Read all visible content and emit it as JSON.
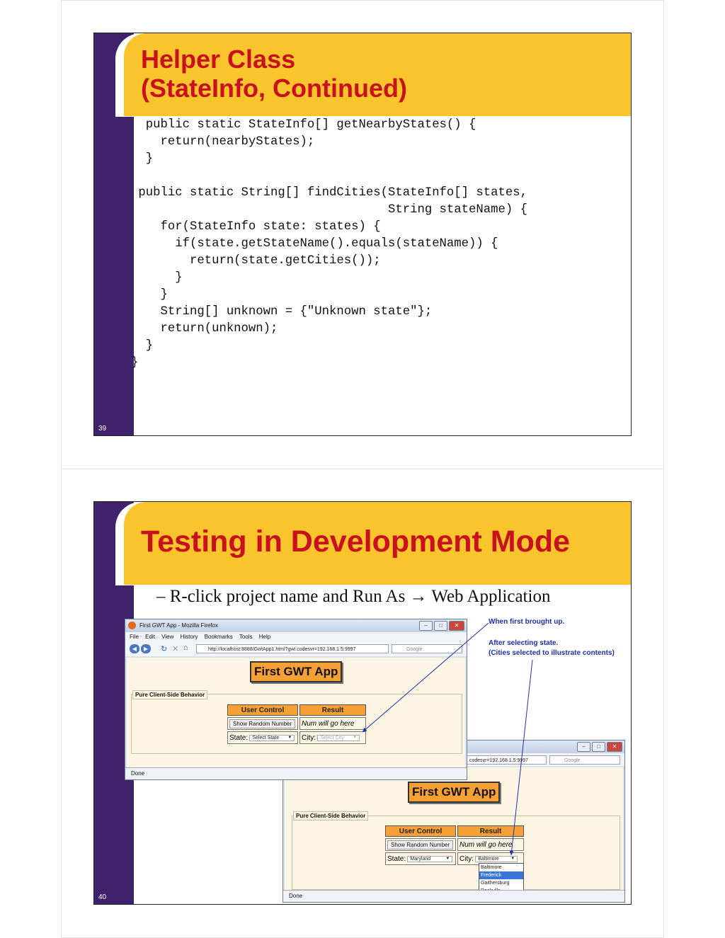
{
  "slide1": {
    "title_line1": "Helper Class",
    "title_line2": "(StateInfo, Continued)",
    "code": "  public static StateInfo[] getNearbyStates() {\n    return(nearbyStates);\n  }\n\n public static String[] findCities(StateInfo[] states,\n                                   String stateName) {\n    for(StateInfo state: states) {\n      if(state.getStateName().equals(stateName)) {\n        return(state.getCities());\n      }\n    }\n    String[] unknown = {\"Unknown state\"};\n    return(unknown);\n  }\n}",
    "number": "39"
  },
  "slide2": {
    "title": "Testing in Development Mode",
    "bullet": "– R-click project name and Run As → Web Application",
    "number": "40",
    "annotations": {
      "first": "When first brought up.",
      "after": "After selecting state.",
      "after2": "(Cities selected to illustrate contents)"
    },
    "browser1": {
      "window_title": "First GWT App - Mozilla Firefox",
      "menus": [
        "File",
        "Edit",
        "View",
        "History",
        "Bookmarks",
        "Tools",
        "Help"
      ],
      "url": "http://localhost:8888/GwtApp1.html?gwt.codesvr=192.168.1.5:9997",
      "search_placeholder": "Google",
      "app_title": "First GWT App",
      "legend": "Pure Client-Side Behavior",
      "col_user_control": "User Control",
      "col_result": "Result",
      "button_label": "Show Random Number",
      "result_text": "Num will go here",
      "state_label": "State:",
      "state_value": "Select State",
      "city_label": "City:",
      "city_value": "Select City",
      "status": "Done"
    },
    "browser2": {
      "url": ".codesvr=192.168.1.5:9997",
      "search_placeholder": "Google",
      "app_title": "First GWT App",
      "legend": "Pure Client-Side Behavior",
      "col_user_control": "User Control",
      "col_result": "Result",
      "button_label": "Show Random Number",
      "result_text": "Num will go here",
      "state_label": "State:",
      "state_value": "Maryland",
      "city_label": "City:",
      "city_value": "Baltimore",
      "cities": [
        "Baltimore",
        "Frederick",
        "Gaithersburg",
        "Rockville"
      ],
      "highlighted_city": "Frederick",
      "status": "Done"
    }
  }
}
